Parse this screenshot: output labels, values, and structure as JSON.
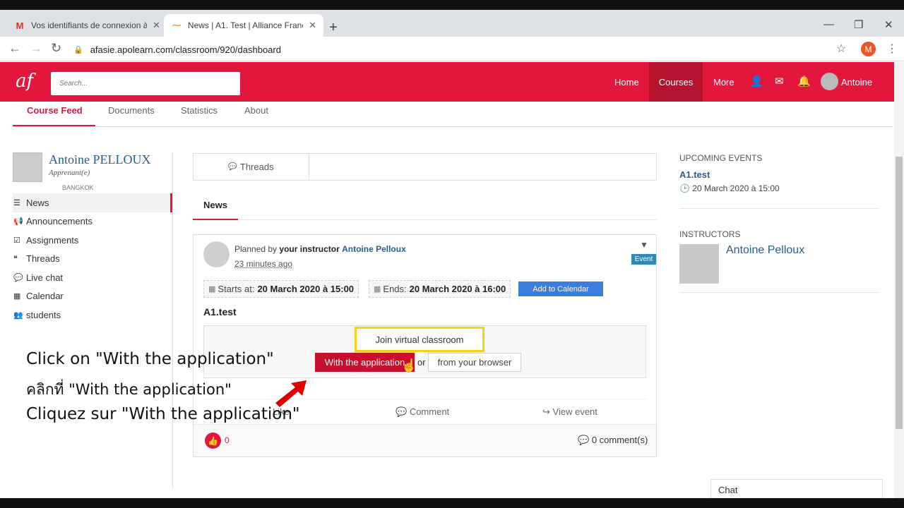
{
  "browser": {
    "tabs": [
      {
        "title": "Vos identifiants de connexion à A",
        "favicon": "M"
      },
      {
        "title": "News | A1. Test | Alliance Françai",
        "favicon": "⁓"
      }
    ],
    "url": "afasie.apolearn.com/classroom/920/dashboard",
    "profile_initial": "M"
  },
  "header": {
    "logo": "af",
    "search_placeholder": "Search...",
    "nav": [
      "Home",
      "Courses",
      "More"
    ],
    "user": "Antoine",
    "accent": "#e3173d"
  },
  "subtabs": [
    "Course Feed",
    "Documents",
    "Statistics",
    "About"
  ],
  "profile": {
    "name": "Antoine PELLOUX",
    "role": "Apprenant(e)",
    "city": "BANGKOK"
  },
  "leftnav": [
    {
      "icon": "list-icon",
      "glyph": "☰",
      "label": "News"
    },
    {
      "icon": "bullhorn-icon",
      "glyph": "📢",
      "label": "Announcements"
    },
    {
      "icon": "check-square-icon",
      "glyph": "☑",
      "label": "Assignments"
    },
    {
      "icon": "quote-icon",
      "glyph": "❝",
      "label": "Threads"
    },
    {
      "icon": "chat-icon",
      "glyph": "💬",
      "label": "Live chat"
    },
    {
      "icon": "calendar-icon",
      "glyph": "▦",
      "label": "Calendar"
    },
    {
      "icon": "users-icon",
      "glyph": "👥",
      "label": "students"
    }
  ],
  "center": {
    "threads_label": "Threads",
    "news_heading": "News",
    "post": {
      "planned_prefix": "Planned by ",
      "planned_by": "your instructor",
      "instructor": "Antoine Pelloux",
      "time_ago": "23 minutes ago",
      "badge": "Event",
      "starts_label": "Starts at:",
      "starts_value": "20 March 2020 à 15:00",
      "ends_label": "Ends:",
      "ends_value": "20 March 2020 à 16:00",
      "add_calendar": "Add to Calendar",
      "title": "A1.test",
      "join_label": "Join virtual classroom",
      "btn_application": "With the application",
      "or": "or",
      "btn_browser": "from your browser",
      "actions": [
        "Like",
        "Comment",
        "View event"
      ],
      "likes": "0",
      "comments": "0 comment(s)"
    }
  },
  "right": {
    "upcoming_title": "UPCOMING EVENTS",
    "upcoming_event": "A1.test",
    "upcoming_date": "20 March 2020 à 15:00",
    "instructors_title": "INSTRUCTORS",
    "instructor_name": "Antoine Pelloux"
  },
  "chat_label": "Chat",
  "overlay": {
    "line_en": "Click on  \"With the application\"",
    "line_th": "คลิกที่ \"With the application\"",
    "line_fr": "Cliquez sur \"With the application\""
  }
}
